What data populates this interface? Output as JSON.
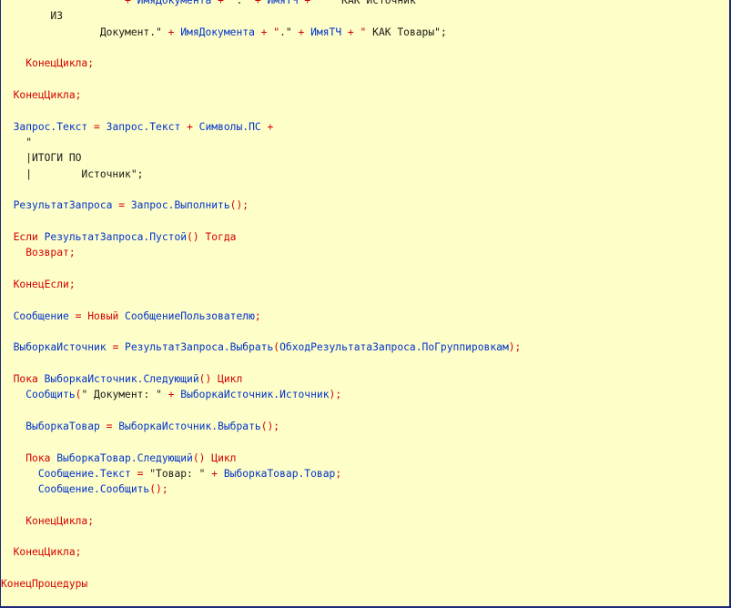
{
  "editor": {
    "lines": [
      [
        {
          "t": "                \"\"\" ",
          "c": "str"
        },
        {
          "t": "+ ",
          "c": "op"
        },
        {
          "t": "ИмяДокумента",
          "c": "id"
        },
        {
          "t": " + \"",
          "c": "op"
        },
        {
          "t": ".\" ",
          "c": "str"
        },
        {
          "t": "+ ",
          "c": "op"
        },
        {
          "t": "ИмяТЧ",
          "c": "id"
        },
        {
          "t": " + \"",
          "c": "op"
        },
        {
          "t": "\"\" КАК Источник",
          "c": "str"
        }
      ],
      [
        {
          "t": "        ИЗ",
          "c": "str"
        }
      ],
      [
        {
          "t": "                Документ.\" ",
          "c": "str"
        },
        {
          "t": "+ ",
          "c": "op"
        },
        {
          "t": "ИмяДокумента",
          "c": "id"
        },
        {
          "t": " + \"",
          "c": "op"
        },
        {
          "t": ".\" ",
          "c": "str"
        },
        {
          "t": "+ ",
          "c": "op"
        },
        {
          "t": "ИмяТЧ",
          "c": "id"
        },
        {
          "t": " + \"",
          "c": "op"
        },
        {
          "t": " КАК Товары\";",
          "c": "str"
        }
      ],
      [],
      [
        {
          "t": "    ",
          "c": "str"
        },
        {
          "t": "КонецЦикла;",
          "c": "kw"
        }
      ],
      [],
      [
        {
          "t": "  ",
          "c": "str"
        },
        {
          "t": "КонецЦикла;",
          "c": "kw"
        }
      ],
      [],
      [
        {
          "t": "  ",
          "c": "str"
        },
        {
          "t": "Запрос.Текст",
          "c": "id"
        },
        {
          "t": " = ",
          "c": "op"
        },
        {
          "t": "Запрос.Текст",
          "c": "id"
        },
        {
          "t": " + ",
          "c": "op"
        },
        {
          "t": "Символы.ПС",
          "c": "id"
        },
        {
          "t": " +",
          "c": "op"
        }
      ],
      [
        {
          "t": "    \"",
          "c": "str"
        }
      ],
      [
        {
          "t": "    |ИТОГИ ПО",
          "c": "str"
        }
      ],
      [
        {
          "t": "    |        Источник\";",
          "c": "str"
        }
      ],
      [],
      [
        {
          "t": "  ",
          "c": "str"
        },
        {
          "t": "РезультатЗапроса",
          "c": "id"
        },
        {
          "t": " = ",
          "c": "op"
        },
        {
          "t": "Запрос.Выполнить",
          "c": "id"
        },
        {
          "t": "();",
          "c": "op"
        }
      ],
      [],
      [
        {
          "t": "  ",
          "c": "str"
        },
        {
          "t": "Если ",
          "c": "kw"
        },
        {
          "t": "РезультатЗапроса.Пустой",
          "c": "id"
        },
        {
          "t": "() ",
          "c": "op"
        },
        {
          "t": "Тогда",
          "c": "kw"
        }
      ],
      [
        {
          "t": "    ",
          "c": "str"
        },
        {
          "t": "Возврат;",
          "c": "kw"
        }
      ],
      [],
      [
        {
          "t": "  ",
          "c": "str"
        },
        {
          "t": "КонецЕсли;",
          "c": "kw"
        }
      ],
      [],
      [
        {
          "t": "  ",
          "c": "str"
        },
        {
          "t": "Сообщение",
          "c": "id"
        },
        {
          "t": " = ",
          "c": "op"
        },
        {
          "t": "Новый ",
          "c": "kw"
        },
        {
          "t": "СообщениеПользователю",
          "c": "id"
        },
        {
          "t": ";",
          "c": "op"
        }
      ],
      [],
      [
        {
          "t": "  ",
          "c": "str"
        },
        {
          "t": "ВыборкаИсточник",
          "c": "id"
        },
        {
          "t": " = ",
          "c": "op"
        },
        {
          "t": "РезультатЗапроса.Выбрать",
          "c": "id"
        },
        {
          "t": "(",
          "c": "op"
        },
        {
          "t": "ОбходРезультатаЗапроса.ПоГруппировкам",
          "c": "id"
        },
        {
          "t": ");",
          "c": "op"
        }
      ],
      [],
      [
        {
          "t": "  ",
          "c": "str"
        },
        {
          "t": "Пока ",
          "c": "kw"
        },
        {
          "t": "ВыборкаИсточник.Следующий",
          "c": "id"
        },
        {
          "t": "() ",
          "c": "op"
        },
        {
          "t": "Цикл",
          "c": "kw"
        }
      ],
      [
        {
          "t": "    ",
          "c": "str"
        },
        {
          "t": "Сообщить",
          "c": "id"
        },
        {
          "t": "(",
          "c": "op"
        },
        {
          "t": "\" Документ: \" ",
          "c": "str"
        },
        {
          "t": "+ ",
          "c": "op"
        },
        {
          "t": "ВыборкаИсточник.Источник",
          "c": "id"
        },
        {
          "t": ");",
          "c": "op"
        }
      ],
      [],
      [
        {
          "t": "    ",
          "c": "str"
        },
        {
          "t": "ВыборкаТовар",
          "c": "id"
        },
        {
          "t": " = ",
          "c": "op"
        },
        {
          "t": "ВыборкаИсточник.Выбрать",
          "c": "id"
        },
        {
          "t": "();",
          "c": "op"
        }
      ],
      [],
      [
        {
          "t": "    ",
          "c": "str"
        },
        {
          "t": "Пока ",
          "c": "kw"
        },
        {
          "t": "ВыборкаТовар.Следующий",
          "c": "id"
        },
        {
          "t": "() ",
          "c": "op"
        },
        {
          "t": "Цикл",
          "c": "kw"
        }
      ],
      [
        {
          "t": "      ",
          "c": "str"
        },
        {
          "t": "Сообщение.Текст",
          "c": "id"
        },
        {
          "t": " = ",
          "c": "op"
        },
        {
          "t": "\"Товар: \" ",
          "c": "str"
        },
        {
          "t": "+ ",
          "c": "op"
        },
        {
          "t": "ВыборкаТовар.Товар",
          "c": "id"
        },
        {
          "t": ";",
          "c": "op"
        }
      ],
      [
        {
          "t": "      ",
          "c": "str"
        },
        {
          "t": "Сообщение.Сообщить",
          "c": "id"
        },
        {
          "t": "();",
          "c": "op"
        }
      ],
      [],
      [
        {
          "t": "    ",
          "c": "str"
        },
        {
          "t": "КонецЦикла;",
          "c": "kw"
        }
      ],
      [],
      [
        {
          "t": "  ",
          "c": "str"
        },
        {
          "t": "КонецЦикла;",
          "c": "kw"
        }
      ],
      [],
      [
        {
          "t": "КонецПроцедуры",
          "c": "kw"
        }
      ]
    ]
  }
}
